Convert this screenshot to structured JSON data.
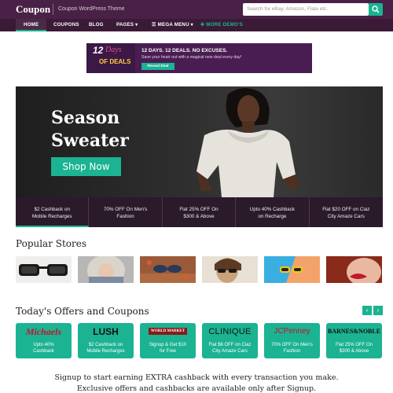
{
  "header": {
    "logo": "Coupon",
    "tagline": "Coupon WordPress Theme",
    "search_placeholder": "Search for eBay, Amazon, Flala etc.",
    "search_icon": "search-icon"
  },
  "nav": {
    "items": [
      {
        "label": "HOME"
      },
      {
        "label": "COUPONS"
      },
      {
        "label": "BLOG"
      },
      {
        "label": "PAGES ▾"
      },
      {
        "label": "☰ MEGA MENU ▾"
      },
      {
        "label": "✚ MORE DEMO'S"
      }
    ]
  },
  "ad": {
    "num": "12",
    "days": "Days",
    "deals": "OF DEALS",
    "headline": "12 DAYS. 12 DEALS. NO EXCUSES.",
    "subline": "Save your heart out with a magical new deal every day!",
    "button": "Reveal Deal"
  },
  "hero": {
    "title_line1": "Season",
    "title_line2": "Sweater",
    "cta": "Shop Now",
    "strip": [
      {
        "line1": "$2 Cashback on",
        "line2": "Mobile Recharges"
      },
      {
        "line1": "70% OFF On Men's",
        "line2": "Fashion"
      },
      {
        "line1": "Flat 25% OFF On",
        "line2": "$300 & Above"
      },
      {
        "line1": "Upto 40% Cashback",
        "line2": "on Recharge"
      },
      {
        "line1": "Flat $20 OFF on Ciaz",
        "line2": "City Amaze Cars"
      }
    ]
  },
  "popular": {
    "title": "Popular Stores"
  },
  "offers": {
    "title": "Today's Offers and Coupons",
    "prev": "‹",
    "next": "›",
    "cards": [
      {
        "brand": "Michaels",
        "line1": "Upto 40%",
        "line2": "Cashback"
      },
      {
        "brand": "LUSH",
        "line1": "$2 Cashback on",
        "line2": "Mobile Recharges"
      },
      {
        "brand": "WORLD MARKET",
        "line1": "Signup & Get $10",
        "line2": "for Free"
      },
      {
        "brand": "CLINIQUE",
        "line1": "Flat $6 OFF on Ciaz",
        "line2": "City Amaze Cars"
      },
      {
        "brand": "JCPenney",
        "line1": "70% OFF On Men's",
        "line2": "Fashion"
      },
      {
        "brand": "BARNES&NOBLE",
        "line1": "Flat 25% OFF On",
        "line2": "$300 & Above"
      }
    ]
  },
  "signup": {
    "line1": "Signup to start earning EXTRA cashback with every transaction you make.",
    "line2": "Exclusive offers and cashbacks are available only after Signup."
  },
  "colors": {
    "header_bg": "#4a2146",
    "nav_bg": "#3a1a37",
    "accent": "#1bb392"
  }
}
